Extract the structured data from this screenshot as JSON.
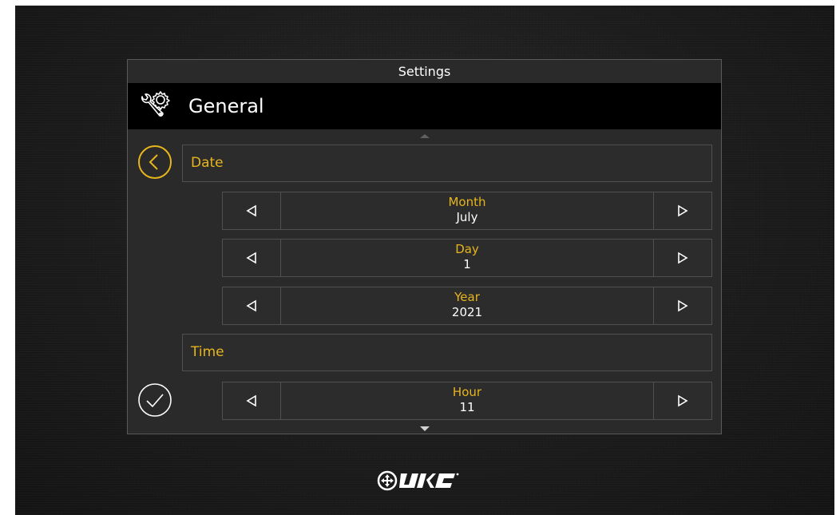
{
  "panel": {
    "title": "Settings"
  },
  "header": {
    "icon": "wrench-gear-icon",
    "title": "General"
  },
  "sections": {
    "date": {
      "label": "Date",
      "steppers": [
        {
          "label": "Month",
          "value": "July"
        },
        {
          "label": "Day",
          "value": "1"
        },
        {
          "label": "Year",
          "value": "2021"
        }
      ]
    },
    "time": {
      "label": "Time",
      "steppers": [
        {
          "label": "Hour",
          "value": "11"
        }
      ]
    }
  },
  "buttons": {
    "back_icon": "chevron-left-circle-icon",
    "confirm_icon": "check-circle-icon"
  },
  "brand": {
    "logo": "URC"
  },
  "colors": {
    "accent": "#e7b51c",
    "panel_bg": "#2a2a2a",
    "header_bg": "#000000",
    "text": "#ffffff"
  }
}
